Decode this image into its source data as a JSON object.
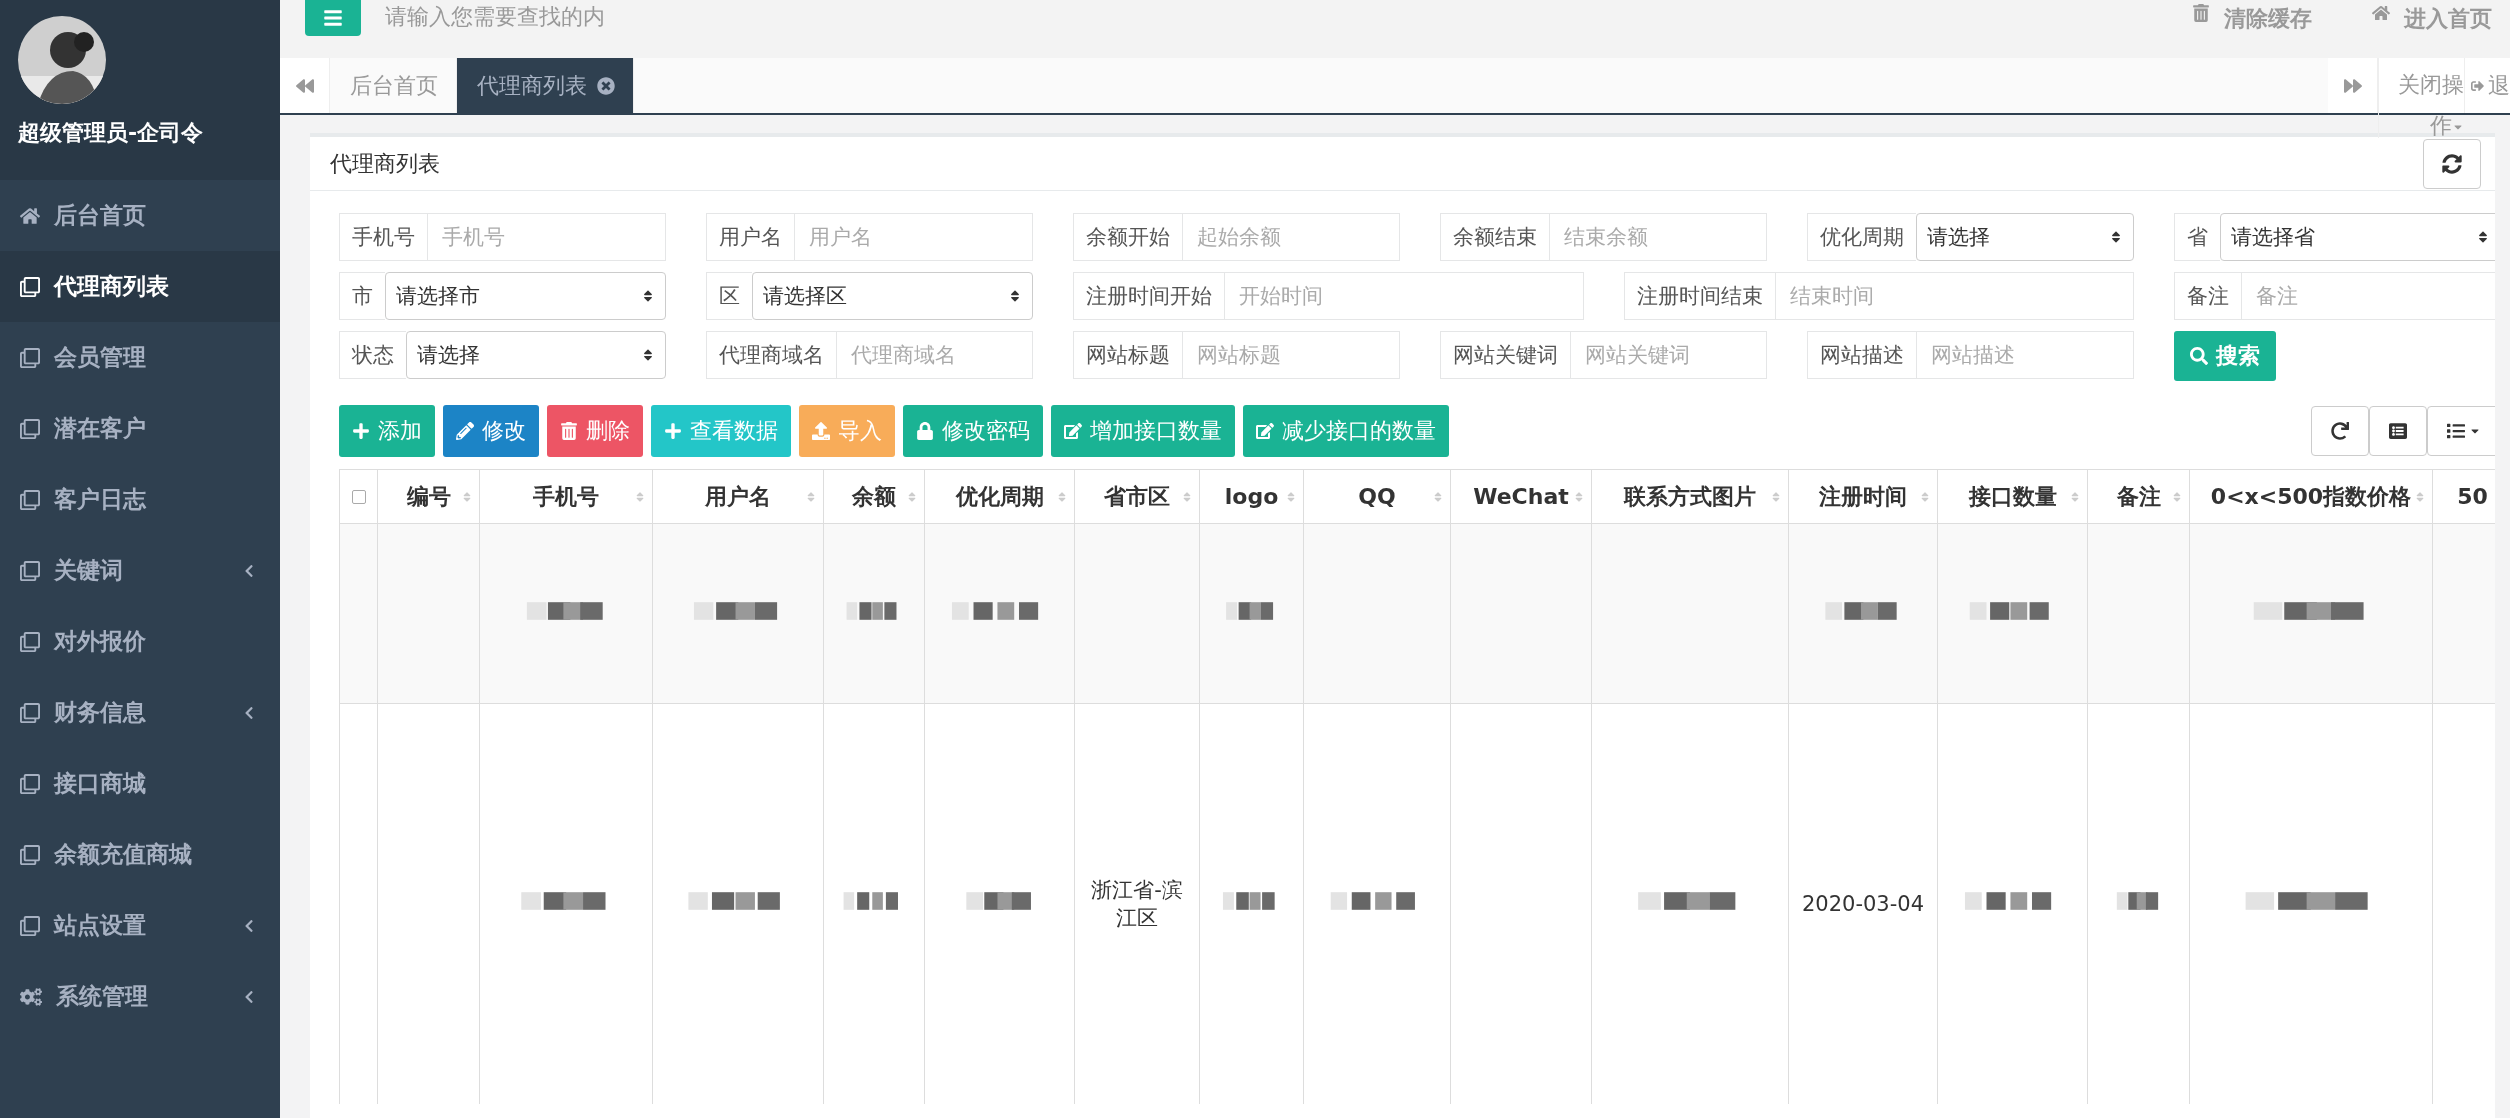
{
  "sidebar": {
    "user_name": "超级管理员-企司令",
    "items": [
      {
        "label": "后台首页",
        "kind": "home",
        "selected": false,
        "has_children": false
      },
      {
        "label": "代理商列表",
        "kind": "page",
        "selected": true,
        "has_children": false
      },
      {
        "label": "会员管理",
        "kind": "page",
        "selected": false,
        "has_children": false
      },
      {
        "label": "潜在客户",
        "kind": "page",
        "selected": false,
        "has_children": false
      },
      {
        "label": "客户日志",
        "kind": "page",
        "selected": false,
        "has_children": false
      },
      {
        "label": "关键词",
        "kind": "page",
        "selected": false,
        "has_children": true
      },
      {
        "label": "对外报价",
        "kind": "page",
        "selected": false,
        "has_children": false
      },
      {
        "label": "财务信息",
        "kind": "page",
        "selected": false,
        "has_children": true
      },
      {
        "label": "接口商城",
        "kind": "page",
        "selected": false,
        "has_children": false
      },
      {
        "label": "余额充值商城",
        "kind": "page",
        "selected": false,
        "has_children": false
      },
      {
        "label": "站点设置",
        "kind": "page",
        "selected": false,
        "has_children": true
      },
      {
        "label": "系统管理",
        "kind": "system",
        "selected": false,
        "has_children": true
      }
    ]
  },
  "top_bar": {
    "search_placeholder": "请输入您需要查找的内",
    "links": [
      {
        "label": "清除缓存",
        "kind": "clear"
      },
      {
        "label": "进入首页",
        "kind": "home"
      }
    ]
  },
  "tabs": [
    {
      "label": "后台首页",
      "selected": false,
      "closable": false
    },
    {
      "label": "代理商列表",
      "selected": true,
      "closable": true
    }
  ],
  "tab_actions": {
    "close_menu": "关闭操作",
    "logout": "退"
  },
  "panel": {
    "title": "代理商列表"
  },
  "filters": [
    {
      "label": "手机号",
      "kind": "input",
      "placeholder": "手机号",
      "wide": false
    },
    {
      "label": "用户名",
      "kind": "input",
      "placeholder": "用户名",
      "wide": false
    },
    {
      "label": "余额开始",
      "kind": "input",
      "placeholder": "起始余额",
      "wide": false
    },
    {
      "label": "余额结束",
      "kind": "input",
      "placeholder": "结束余额",
      "wide": false
    },
    {
      "label": "优化周期",
      "kind": "select",
      "value": "请选择",
      "wide": false
    },
    {
      "label": "省",
      "kind": "select",
      "value": "请选择省",
      "wide": false
    },
    {
      "label": "市",
      "kind": "select",
      "value": "请选择市",
      "wide": false
    },
    {
      "label": "区",
      "kind": "select",
      "value": "请选择区",
      "wide": false
    },
    {
      "label": "注册时间开始",
      "kind": "input",
      "placeholder": "开始时间",
      "wide": true
    },
    {
      "label": "注册时间结束",
      "kind": "input",
      "placeholder": "结束时间",
      "wide": true
    },
    {
      "label": "备注",
      "kind": "input",
      "placeholder": "备注",
      "wide": false
    },
    {
      "label": "状态",
      "kind": "select",
      "value": "请选择",
      "wide": false
    },
    {
      "label": "代理商域名",
      "kind": "input",
      "placeholder": "代理商域名",
      "wide": false
    },
    {
      "label": "网站标题",
      "kind": "input",
      "placeholder": "网站标题",
      "wide": false
    },
    {
      "label": "网站关键词",
      "kind": "input",
      "placeholder": "网站关键词",
      "wide": false
    },
    {
      "label": "网站描述",
      "kind": "input",
      "placeholder": "网站描述",
      "wide": false
    }
  ],
  "search_button": "搜索",
  "toolbar": [
    {
      "label": "添加",
      "kind": "add",
      "color": "#1ab394"
    },
    {
      "label": "修改",
      "kind": "modify",
      "color": "#1c84c6"
    },
    {
      "label": "删除",
      "kind": "delete",
      "color": "#ed5565"
    },
    {
      "label": "查看数据",
      "kind": "add",
      "color": "#23c6c8"
    },
    {
      "label": "导入",
      "kind": "import",
      "color": "#f8ac59"
    },
    {
      "label": "修改密码",
      "kind": "password",
      "color": "#1ab394"
    },
    {
      "label": "增加接口数量",
      "kind": "edit",
      "color": "#1ab394"
    },
    {
      "label": "减少接口的数量",
      "kind": "edit",
      "color": "#1ab394"
    }
  ],
  "table": {
    "select_all_checked": false,
    "columns": [
      "编号",
      "手机号",
      "用户名",
      "余额",
      "优化周期",
      "省市区",
      "logo",
      "QQ",
      "WeChat",
      "联系方式图片",
      "注册时间",
      "接口数量",
      "备注",
      "0<x<500指数价格",
      "50"
    ],
    "rows": [
      {
        "cells": [
          {
            "kind": "empty"
          },
          {
            "kind": "redacted"
          },
          {
            "kind": "redacted"
          },
          {
            "kind": "redacted"
          },
          {
            "kind": "redacted"
          },
          {
            "kind": "empty"
          },
          {
            "kind": "redacted"
          },
          {
            "kind": "empty"
          },
          {
            "kind": "empty"
          },
          {
            "kind": "empty"
          },
          {
            "kind": "redacted"
          },
          {
            "kind": "redacted"
          },
          {
            "kind": "empty"
          },
          {
            "kind": "redacted"
          },
          {
            "kind": "empty"
          }
        ]
      },
      {
        "cells": [
          {
            "kind": "empty"
          },
          {
            "kind": "redacted"
          },
          {
            "kind": "redacted"
          },
          {
            "kind": "redacted"
          },
          {
            "kind": "redacted"
          },
          {
            "kind": "text",
            "text": "浙江省-滨江区"
          },
          {
            "kind": "redacted"
          },
          {
            "kind": "redacted"
          },
          {
            "kind": "empty"
          },
          {
            "kind": "redacted"
          },
          {
            "kind": "text",
            "text": "2020-03-04"
          },
          {
            "kind": "redacted"
          },
          {
            "kind": "redacted"
          },
          {
            "kind": "redacted"
          },
          {
            "kind": "empty"
          }
        ]
      }
    ]
  }
}
